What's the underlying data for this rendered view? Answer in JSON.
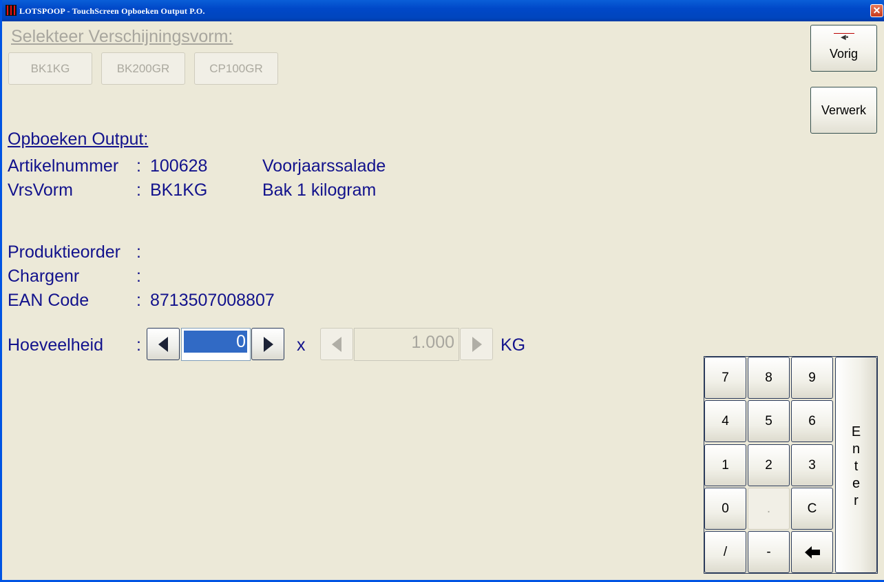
{
  "window": {
    "title": "LOTSPOOP - TouchScreen Opboeken Output P.O.",
    "close_glyph": "✕"
  },
  "select": {
    "title": "Selekteer Verschijningsvorm:",
    "options": [
      "BK1KG",
      "BK200GR",
      "CP100GR"
    ]
  },
  "side": {
    "vorig_label": "Vorig",
    "vorig_icon": "back-arrow-icon",
    "verwerk_label": "Verwerk"
  },
  "output": {
    "title": "Opboeken Output:",
    "artikel": {
      "label": "Artikelnummer",
      "sep": ":",
      "value": "100628",
      "desc": "Voorjaarssalade"
    },
    "vrsvorm": {
      "label": "VrsVorm",
      "sep": ":",
      "value": "BK1KG",
      "desc": "Bak 1 kilogram"
    },
    "produktieorder": {
      "label": "Produktieorder",
      "sep": ":",
      "value": ""
    },
    "chargenr": {
      "label": "Chargenr",
      "sep": ":",
      "value": ""
    },
    "ean": {
      "label": "EAN Code",
      "sep": ":",
      "value": "8713507008807"
    }
  },
  "quantity": {
    "label": "Hoeveelheid",
    "sep": ":",
    "value": "0",
    "times": "x",
    "unit_value": "1.000",
    "unit": "KG"
  },
  "numpad": {
    "keys": [
      "7",
      "8",
      "9",
      "4",
      "5",
      "6",
      "1",
      "2",
      "3",
      "0",
      ".",
      "C",
      "/",
      "-"
    ],
    "backspace_icon": "backspace-arrow-icon",
    "enter_letters": [
      "E",
      "n",
      "t",
      "e",
      "r"
    ]
  },
  "colors": {
    "text_blue": "#12128c",
    "disabled_text": "#a8a69e",
    "background": "#ece9d8",
    "selection": "#316ac5"
  }
}
